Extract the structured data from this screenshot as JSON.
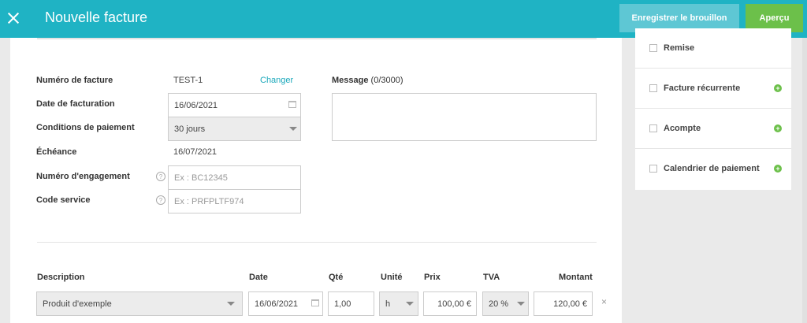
{
  "header": {
    "title": "Nouvelle facture",
    "draft_label": "Enregistrer le brouillon",
    "preview_label": "Aperçu"
  },
  "form": {
    "invoice_number": {
      "label": "Numéro de facture",
      "value": "TEST-1",
      "change_link": "Changer"
    },
    "invoice_date": {
      "label": "Date de facturation",
      "value": "16/06/2021"
    },
    "payment_terms": {
      "label": "Conditions de paiement",
      "value": "30 jours"
    },
    "due_date": {
      "label": "Échéance",
      "value": "16/07/2021"
    },
    "commitment_number": {
      "label": "Numéro d'engagement",
      "placeholder": "Ex : BC12345"
    },
    "service_code": {
      "label": "Code service",
      "placeholder": "Ex : PRFPLTF974"
    },
    "message": {
      "label": "Message",
      "counter": "(0/3000)"
    }
  },
  "table": {
    "headers": {
      "description": "Description",
      "date": "Date",
      "qty": "Qté",
      "unit": "Unité",
      "price": "Prix",
      "vat": "TVA",
      "amount": "Montant"
    },
    "row": {
      "description": "Produit d'exemple",
      "date": "16/06/2021",
      "qty": "1,00",
      "unit": "h",
      "price": "100,00 €",
      "vat": "20 %",
      "amount": "120,00 €",
      "remove": "×"
    }
  },
  "sidebar": {
    "options": [
      {
        "label": "Remise",
        "has_plus": false
      },
      {
        "label": "Facture récurrente",
        "has_plus": true
      },
      {
        "label": "Acompte",
        "has_plus": true
      },
      {
        "label": "Calendrier de paiement",
        "has_plus": true
      }
    ]
  },
  "colors": {
    "header": "#1fb3c4",
    "draft_button": "#5ec7d4",
    "preview_button": "#6cc04a",
    "link": "#1aa8bb"
  }
}
